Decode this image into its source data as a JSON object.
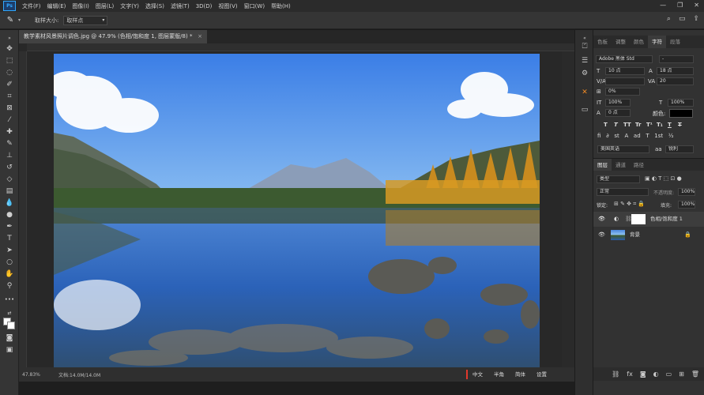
{
  "app": {
    "logo": "Ps"
  },
  "menu": [
    "文件(F)",
    "编辑(E)",
    "图像(I)",
    "图层(L)",
    "文字(Y)",
    "选择(S)",
    "滤镜(T)",
    "3D(D)",
    "视图(V)",
    "窗口(W)",
    "帮助(H)"
  ],
  "options": {
    "sample_size_label": "取样大小:",
    "sample_size_value": "取样点"
  },
  "document": {
    "tab_title": "教学素材风景照片调色.jpg @ 47.9% (色相/饱和度 1, 图层蒙版/8) *",
    "close": "×"
  },
  "status": {
    "zoom": "47.83%",
    "doc": "文档:14.0M/14.0M",
    "ime": [
      "中文",
      "半角",
      "简体",
      "设置"
    ]
  },
  "character": {
    "tabs": [
      "色板",
      "调整",
      "颜色",
      "字符",
      "段落"
    ],
    "active_tab": "字符",
    "font_family": "Adobe 黑体 Std",
    "font_style": "-",
    "font_size": "10 点",
    "leading": "18 点",
    "kerning": "",
    "tracking": "20",
    "scale_pct": "0%",
    "vertical_scale": "100%",
    "horizontal_scale": "100%",
    "baseline": "0 点",
    "color_label": "颜色:",
    "language": "美国英语",
    "aa_label": "aa",
    "antialias": "锐利",
    "type_buttons": [
      "T",
      "T",
      "TT",
      "Tr",
      "T¹",
      "T₁",
      "T",
      "T"
    ]
  },
  "layers": {
    "tabs": [
      "图层",
      "通道",
      "路径"
    ],
    "active_tab": "图层",
    "filter": "类型",
    "blend_mode": "正常",
    "opacity_label": "不透明度:",
    "opacity": "100%",
    "lock_label": "锁定:",
    "fill_label": "填充:",
    "fill": "100%",
    "items": [
      {
        "name": "色相/饱和度 1",
        "type": "adjustment"
      },
      {
        "name": "背景",
        "type": "image"
      }
    ]
  }
}
